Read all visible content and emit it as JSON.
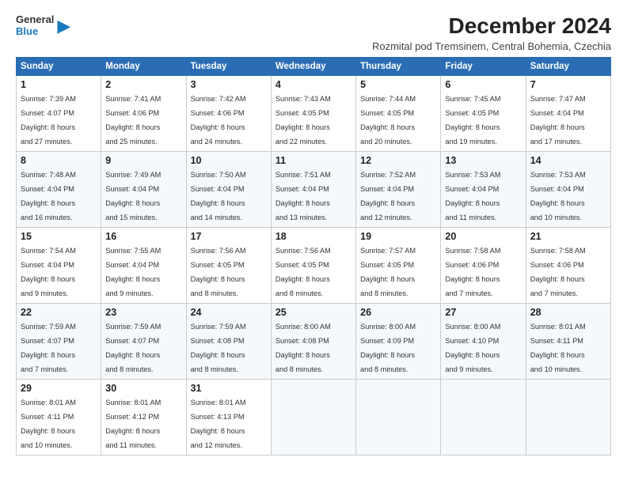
{
  "logo": {
    "general": "General",
    "blue": "Blue",
    "icon": "▶"
  },
  "title": "December 2024",
  "subtitle": "Rozmital pod Tremsinem, Central Bohemia, Czechia",
  "headers": [
    "Sunday",
    "Monday",
    "Tuesday",
    "Wednesday",
    "Thursday",
    "Friday",
    "Saturday"
  ],
  "weeks": [
    [
      {
        "day": "1",
        "detail": "Sunrise: 7:39 AM\nSunset: 4:07 PM\nDaylight: 8 hours\nand 27 minutes."
      },
      {
        "day": "2",
        "detail": "Sunrise: 7:41 AM\nSunset: 4:06 PM\nDaylight: 8 hours\nand 25 minutes."
      },
      {
        "day": "3",
        "detail": "Sunrise: 7:42 AM\nSunset: 4:06 PM\nDaylight: 8 hours\nand 24 minutes."
      },
      {
        "day": "4",
        "detail": "Sunrise: 7:43 AM\nSunset: 4:05 PM\nDaylight: 8 hours\nand 22 minutes."
      },
      {
        "day": "5",
        "detail": "Sunrise: 7:44 AM\nSunset: 4:05 PM\nDaylight: 8 hours\nand 20 minutes."
      },
      {
        "day": "6",
        "detail": "Sunrise: 7:45 AM\nSunset: 4:05 PM\nDaylight: 8 hours\nand 19 minutes."
      },
      {
        "day": "7",
        "detail": "Sunrise: 7:47 AM\nSunset: 4:04 PM\nDaylight: 8 hours\nand 17 minutes."
      }
    ],
    [
      {
        "day": "8",
        "detail": "Sunrise: 7:48 AM\nSunset: 4:04 PM\nDaylight: 8 hours\nand 16 minutes."
      },
      {
        "day": "9",
        "detail": "Sunrise: 7:49 AM\nSunset: 4:04 PM\nDaylight: 8 hours\nand 15 minutes."
      },
      {
        "day": "10",
        "detail": "Sunrise: 7:50 AM\nSunset: 4:04 PM\nDaylight: 8 hours\nand 14 minutes."
      },
      {
        "day": "11",
        "detail": "Sunrise: 7:51 AM\nSunset: 4:04 PM\nDaylight: 8 hours\nand 13 minutes."
      },
      {
        "day": "12",
        "detail": "Sunrise: 7:52 AM\nSunset: 4:04 PM\nDaylight: 8 hours\nand 12 minutes."
      },
      {
        "day": "13",
        "detail": "Sunrise: 7:53 AM\nSunset: 4:04 PM\nDaylight: 8 hours\nand 11 minutes."
      },
      {
        "day": "14",
        "detail": "Sunrise: 7:53 AM\nSunset: 4:04 PM\nDaylight: 8 hours\nand 10 minutes."
      }
    ],
    [
      {
        "day": "15",
        "detail": "Sunrise: 7:54 AM\nSunset: 4:04 PM\nDaylight: 8 hours\nand 9 minutes."
      },
      {
        "day": "16",
        "detail": "Sunrise: 7:55 AM\nSunset: 4:04 PM\nDaylight: 8 hours\nand 9 minutes."
      },
      {
        "day": "17",
        "detail": "Sunrise: 7:56 AM\nSunset: 4:05 PM\nDaylight: 8 hours\nand 8 minutes."
      },
      {
        "day": "18",
        "detail": "Sunrise: 7:56 AM\nSunset: 4:05 PM\nDaylight: 8 hours\nand 8 minutes."
      },
      {
        "day": "19",
        "detail": "Sunrise: 7:57 AM\nSunset: 4:05 PM\nDaylight: 8 hours\nand 8 minutes."
      },
      {
        "day": "20",
        "detail": "Sunrise: 7:58 AM\nSunset: 4:06 PM\nDaylight: 8 hours\nand 7 minutes."
      },
      {
        "day": "21",
        "detail": "Sunrise: 7:58 AM\nSunset: 4:06 PM\nDaylight: 8 hours\nand 7 minutes."
      }
    ],
    [
      {
        "day": "22",
        "detail": "Sunrise: 7:59 AM\nSunset: 4:07 PM\nDaylight: 8 hours\nand 7 minutes."
      },
      {
        "day": "23",
        "detail": "Sunrise: 7:59 AM\nSunset: 4:07 PM\nDaylight: 8 hours\nand 8 minutes."
      },
      {
        "day": "24",
        "detail": "Sunrise: 7:59 AM\nSunset: 4:08 PM\nDaylight: 8 hours\nand 8 minutes."
      },
      {
        "day": "25",
        "detail": "Sunrise: 8:00 AM\nSunset: 4:08 PM\nDaylight: 8 hours\nand 8 minutes."
      },
      {
        "day": "26",
        "detail": "Sunrise: 8:00 AM\nSunset: 4:09 PM\nDaylight: 8 hours\nand 8 minutes."
      },
      {
        "day": "27",
        "detail": "Sunrise: 8:00 AM\nSunset: 4:10 PM\nDaylight: 8 hours\nand 9 minutes."
      },
      {
        "day": "28",
        "detail": "Sunrise: 8:01 AM\nSunset: 4:11 PM\nDaylight: 8 hours\nand 10 minutes."
      }
    ],
    [
      {
        "day": "29",
        "detail": "Sunrise: 8:01 AM\nSunset: 4:11 PM\nDaylight: 8 hours\nand 10 minutes."
      },
      {
        "day": "30",
        "detail": "Sunrise: 8:01 AM\nSunset: 4:12 PM\nDaylight: 8 hours\nand 11 minutes."
      },
      {
        "day": "31",
        "detail": "Sunrise: 8:01 AM\nSunset: 4:13 PM\nDaylight: 8 hours\nand 12 minutes."
      },
      null,
      null,
      null,
      null
    ]
  ]
}
